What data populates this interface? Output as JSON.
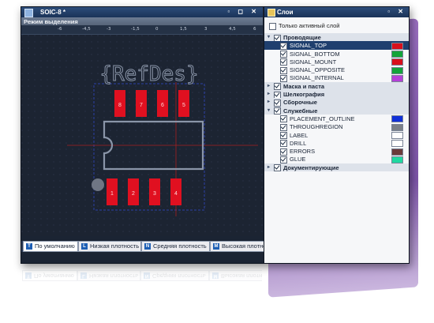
{
  "window": {
    "title": "SOIC-8 *",
    "mode_bar": "Режим выделения",
    "title_buttons": "▫ ◻ ✕"
  },
  "ruler": [
    "-6",
    "-4,5",
    "-3",
    "-1,5",
    "0",
    "1,5",
    "3",
    "4,5",
    "6"
  ],
  "canvas": {
    "refdes": "{RefDes}",
    "top_pins": [
      "8",
      "7",
      "6",
      "5"
    ],
    "bottom_pins": [
      "1",
      "2",
      "3",
      "4"
    ]
  },
  "tabs": [
    {
      "label": "По умолчанию",
      "icon": "Т"
    },
    {
      "label": "Низкая плотность",
      "icon": "L"
    },
    {
      "label": "Средняя плотность",
      "icon": "N"
    },
    {
      "label": "Высокая плотность",
      "icon": "M"
    }
  ],
  "layers_panel": {
    "title": "Слои",
    "title_buttons": "▫ ✕",
    "only_active": "Только активный слой",
    "groups": [
      {
        "label": "Проводящие",
        "expanded": true,
        "checked": true,
        "items": [
          {
            "label": "SIGNAL_TOP",
            "color": "#d8101c",
            "selected": true
          },
          {
            "label": "SIGNAL_BOTTOM",
            "color": "#12a43a"
          },
          {
            "label": "SIGNAL_MOUNT",
            "color": "#d8101c"
          },
          {
            "label": "SIGNAL_OPPOSITE",
            "color": "#12a43a"
          },
          {
            "label": "SIGNAL_INTERNAL",
            "color": "#b640d8"
          }
        ]
      },
      {
        "label": "Маска и паста",
        "expanded": false,
        "checked": true,
        "items": []
      },
      {
        "label": "Шелкография",
        "expanded": false,
        "checked": true,
        "items": []
      },
      {
        "label": "Сборочные",
        "expanded": false,
        "checked": true,
        "items": []
      },
      {
        "label": "Служебные",
        "expanded": true,
        "checked": true,
        "items": [
          {
            "label": "PLACEMENT_OUTLINE",
            "color": "#1030d8"
          },
          {
            "label": "THROUGHREGION",
            "color": "#7a7f88"
          },
          {
            "label": "LABEL",
            "color": "#ffffff"
          },
          {
            "label": "DRILL",
            "color": "#ffffff"
          },
          {
            "label": "ERRORS",
            "color": "#6a3a3a"
          },
          {
            "label": "GLUE",
            "color": "#20d8a0"
          }
        ]
      },
      {
        "label": "Документирующие",
        "expanded": false,
        "checked": true,
        "items": []
      }
    ]
  }
}
